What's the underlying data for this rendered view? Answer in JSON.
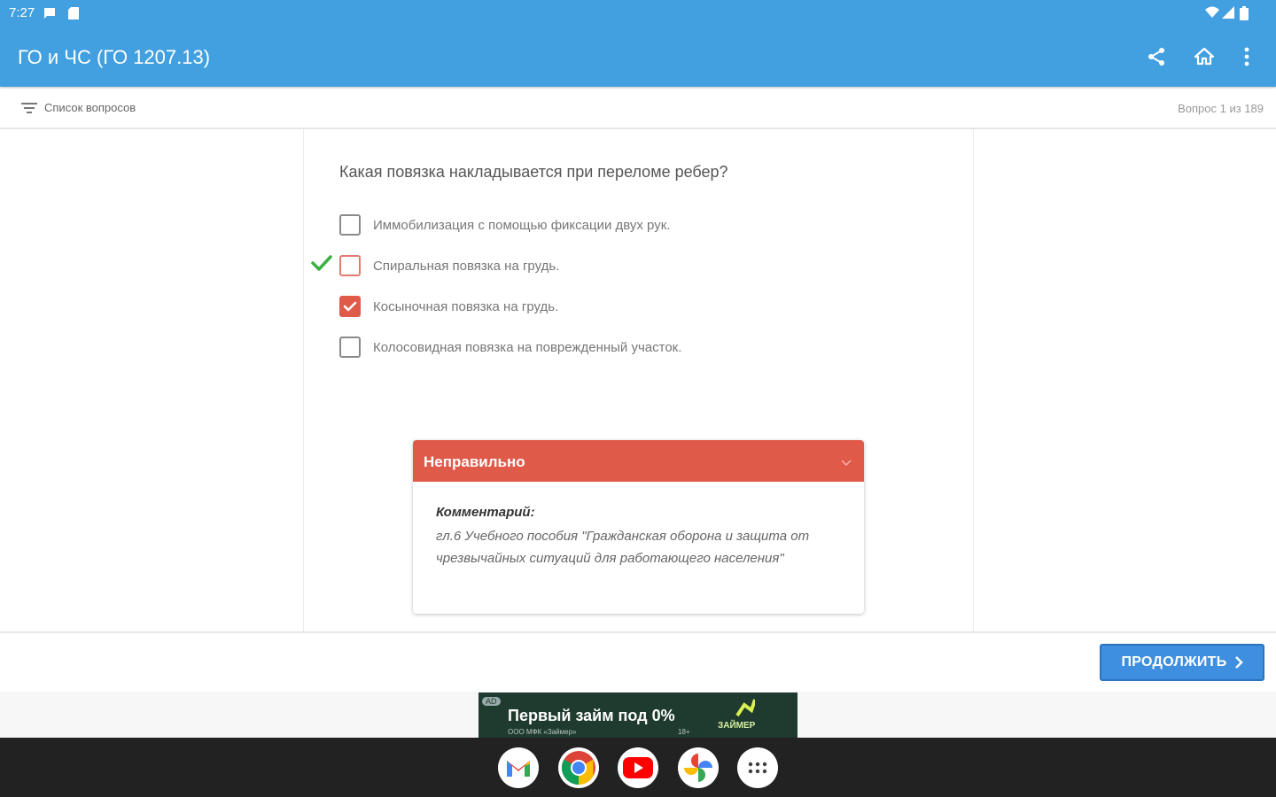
{
  "status_bar": {
    "time": "7:27"
  },
  "app_bar": {
    "title": "ГО и ЧС (ГО 1207.13)",
    "icons": [
      "share-icon",
      "home-icon",
      "more-vert-icon"
    ]
  },
  "sub_bar": {
    "list_label": "Список вопросов",
    "counter": "Вопрос 1 из 189"
  },
  "question": {
    "text": "Какая повязка накладывается при переломе ребер?",
    "options": [
      {
        "label": "Иммобилизация с помощью фиксации двух рук.",
        "checked": false,
        "is_correct": false
      },
      {
        "label": "Спиральная повязка на грудь.",
        "checked": false,
        "is_correct": true
      },
      {
        "label": "Косыночная повязка на грудь.",
        "checked": true,
        "is_correct": false
      },
      {
        "label": "Колосовидная повязка на поврежденный участок.",
        "checked": false,
        "is_correct": false
      }
    ]
  },
  "feedback": {
    "title": "Неправильно",
    "comment_title": "Комментарий:",
    "comment_text": "гл.6 Учебного пособия \"Гражданская оборона и защита от чрезвычайных ситуаций для работающего населения\""
  },
  "footer": {
    "continue_label": "ПРОДОЛЖИТЬ"
  },
  "ad": {
    "badge": "AD",
    "headline": "Первый займ под 0%",
    "sub": "ООО МФК «Займер»",
    "age": "18+",
    "brand": "ЗАЙМЕР"
  },
  "dock": {
    "apps": [
      "gmail-icon",
      "chrome-icon",
      "youtube-icon",
      "photos-icon",
      "app-drawer-icon"
    ]
  },
  "colors": {
    "primary": "#42a0e0",
    "error": "#e05a4a",
    "success": "#3cb043",
    "button": "#3f8fe0"
  }
}
